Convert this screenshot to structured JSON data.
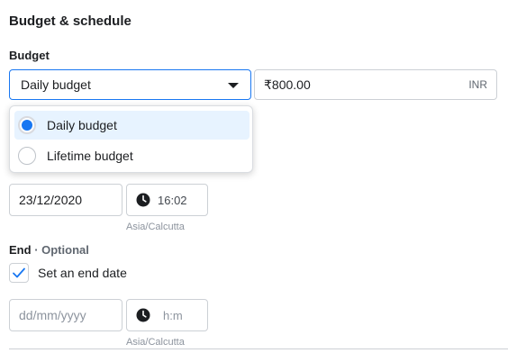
{
  "section": {
    "title": "Budget & schedule"
  },
  "budget": {
    "label": "Budget",
    "select_value": "Daily budget",
    "amount": "₹800.00",
    "currency": "INR",
    "options": [
      {
        "label": "Daily budget",
        "selected": true
      },
      {
        "label": "Lifetime budget",
        "selected": false
      }
    ]
  },
  "start": {
    "date": "23/12/2020",
    "time": "16:02",
    "timezone": "Asia/Calcutta"
  },
  "end": {
    "label": "End",
    "optional_label": "· Optional",
    "checkbox_label": "Set an end date",
    "checked": true,
    "date_placeholder": "dd/mm/yyyy",
    "time_placeholder": "h:m",
    "timezone": "Asia/Calcutta"
  },
  "colors": {
    "accent": "#1877f2",
    "border": "#ccd0d5",
    "selected_bg": "#e7f3ff"
  },
  "icons": {
    "clock": "clock-icon",
    "caret": "caret-down-icon",
    "check": "check-icon"
  }
}
